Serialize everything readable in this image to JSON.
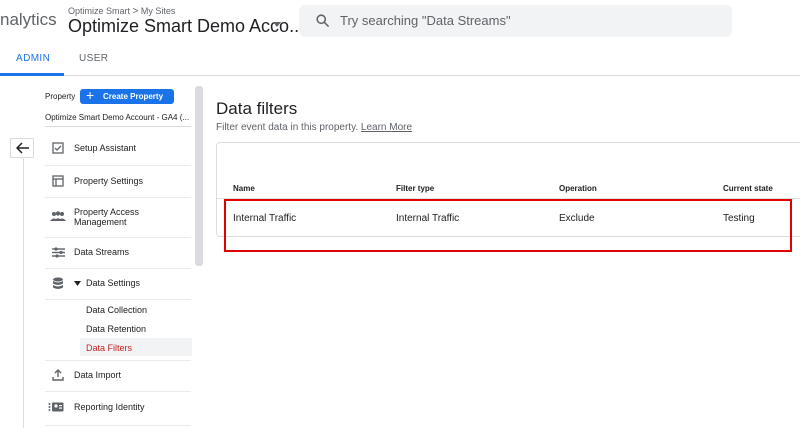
{
  "header": {
    "brand": "nalytics",
    "breadcrumb_root": "Optimize Smart",
    "breadcrumb_sep": ">",
    "breadcrumb_current": "My Sites",
    "account_name": "Optimize Smart Demo Acco...",
    "search_placeholder": "Try searching \"Data Streams\""
  },
  "tabs": [
    {
      "label": "ADMIN",
      "active": true
    },
    {
      "label": "USER",
      "active": false
    }
  ],
  "sidebar": {
    "property_label": "Property",
    "create_button": "Create Property",
    "property_name": "Optimize Smart Demo Account - GA4 (...",
    "items": [
      {
        "label": "Setup Assistant",
        "icon": "checkbox-icon"
      },
      {
        "label": "Property Settings",
        "icon": "property-settings-icon"
      },
      {
        "label": "Property Access\nManagement",
        "icon": "people-icon"
      },
      {
        "label": "Data Streams",
        "icon": "data-streams-icon"
      },
      {
        "label": "Data Settings",
        "icon": "database-icon"
      },
      {
        "label": "Data Import",
        "icon": "upload-icon"
      },
      {
        "label": "Reporting Identity",
        "icon": "reporting-identity-icon"
      }
    ],
    "sub_items": [
      {
        "label": "Data Collection"
      },
      {
        "label": "Data Retention"
      },
      {
        "label": "Data Filters",
        "active": true
      }
    ]
  },
  "main": {
    "title": "Data filters",
    "subtitle": "Filter event data in this property.",
    "learn_more": "Learn More",
    "table": {
      "columns": [
        "Name",
        "Filter type",
        "Operation",
        "Current state"
      ],
      "rows": [
        [
          "Internal Traffic",
          "Internal Traffic",
          "Exclude",
          "Testing"
        ]
      ]
    }
  },
  "colors": {
    "accent": "#1a73e8",
    "active_sub_item": "#c5221f",
    "highlight_box": "#e00000"
  }
}
